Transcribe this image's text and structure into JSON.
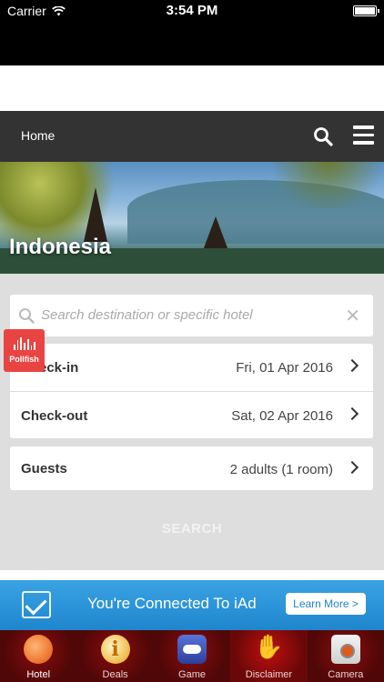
{
  "status_bar": {
    "carrier": "Carrier",
    "time": "3:54 PM"
  },
  "nav": {
    "home_label": "Home"
  },
  "hero": {
    "title": "Indonesia"
  },
  "search": {
    "placeholder": "Search destination or specific hotel"
  },
  "booking": {
    "checkin": {
      "label": "Check-in",
      "value": "Fri, 01 Apr 2016"
    },
    "checkout": {
      "label": "Check-out",
      "value": "Sat, 02 Apr 2016"
    },
    "guests": {
      "label": "Guests",
      "value": "2 adults (1 room)"
    },
    "search_button": "SEARCH"
  },
  "pollfish": {
    "label": "Pollfish"
  },
  "iad": {
    "text": "You're Connected To iAd",
    "button": "Learn More >"
  },
  "tabs": [
    {
      "label": "Hotel",
      "icon": "globe-icon"
    },
    {
      "label": "Deals",
      "icon": "info-icon"
    },
    {
      "label": "Game",
      "icon": "gamepad-icon"
    },
    {
      "label": "Disclaimer",
      "icon": "hand-icon"
    },
    {
      "label": "Camera",
      "icon": "camera-icon"
    }
  ],
  "colors": {
    "nav_bg": "#333333",
    "iad_blue": "#1f86cd",
    "tab_red": "#8b0d0d",
    "pollfish_red": "#e84542"
  }
}
